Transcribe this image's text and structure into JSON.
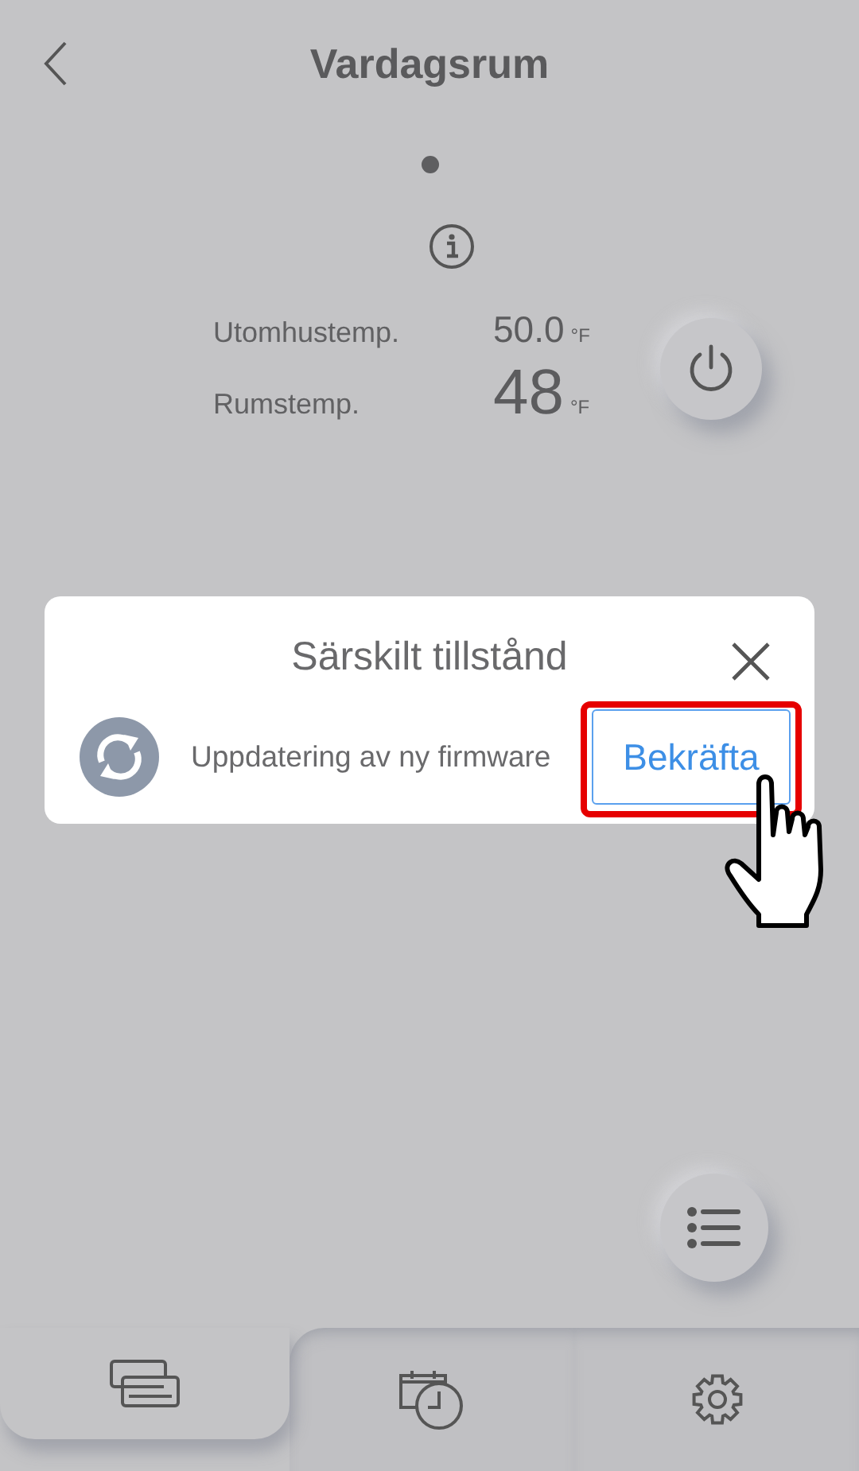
{
  "header": {
    "title": "Vardagsrum"
  },
  "temperatures": [
    {
      "label": "Utomhustemp.",
      "value": "50.0",
      "unit": "°F",
      "kind": "outdoor"
    },
    {
      "label": "Rumstemp.",
      "value": "48",
      "unit": "°F",
      "kind": "room"
    }
  ],
  "dialog": {
    "title": "Särskilt tillstånd",
    "message": "Uppdatering av ny firmware",
    "button": {
      "label": "Bekräfta",
      "highlighted": true
    }
  },
  "tabs": [
    {
      "kind": "devices",
      "selected": true
    },
    {
      "kind": "schedule",
      "selected": false
    },
    {
      "kind": "settings",
      "selected": false
    }
  ]
}
